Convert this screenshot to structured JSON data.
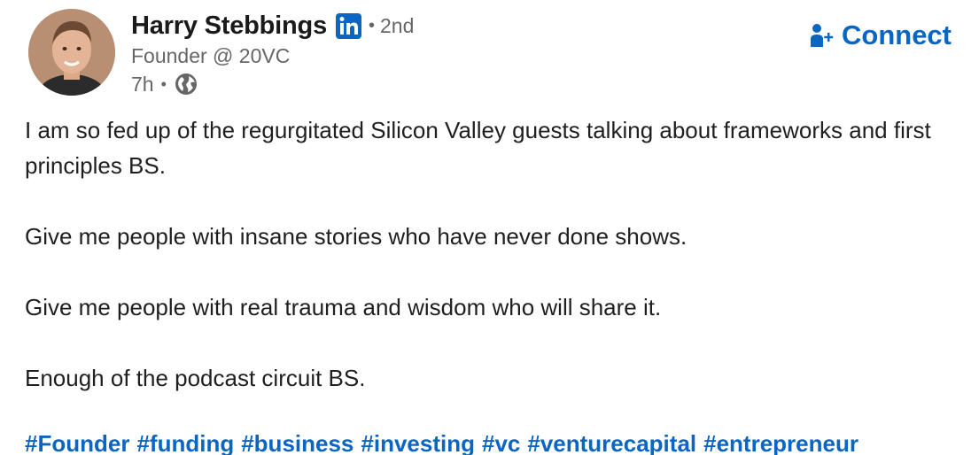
{
  "author": {
    "name": "Harry Stebbings",
    "degree": "2nd",
    "headline": "Founder @ 20VC",
    "timestamp": "7h"
  },
  "icons": {
    "badge": "linkedin-icon",
    "visibility": "globe-icon",
    "connect": "add-person-icon"
  },
  "colors": {
    "accent": "#0a66c2",
    "secondary_text": "#666666"
  },
  "actions": {
    "connect_label": "Connect"
  },
  "post": {
    "paragraphs": [
      "I am so fed up of the regurgitated Silicon Valley guests talking about frameworks and first principles BS.",
      "Give me people with insane stories who have never done shows.",
      "Give me people with real trauma and wisdom who will share it.",
      "Enough of the podcast circuit BS."
    ],
    "hashtags": [
      "#Founder",
      "#funding",
      "#business",
      "#investing",
      "#vc",
      "#venturecapital",
      "#entrepreneur"
    ]
  }
}
